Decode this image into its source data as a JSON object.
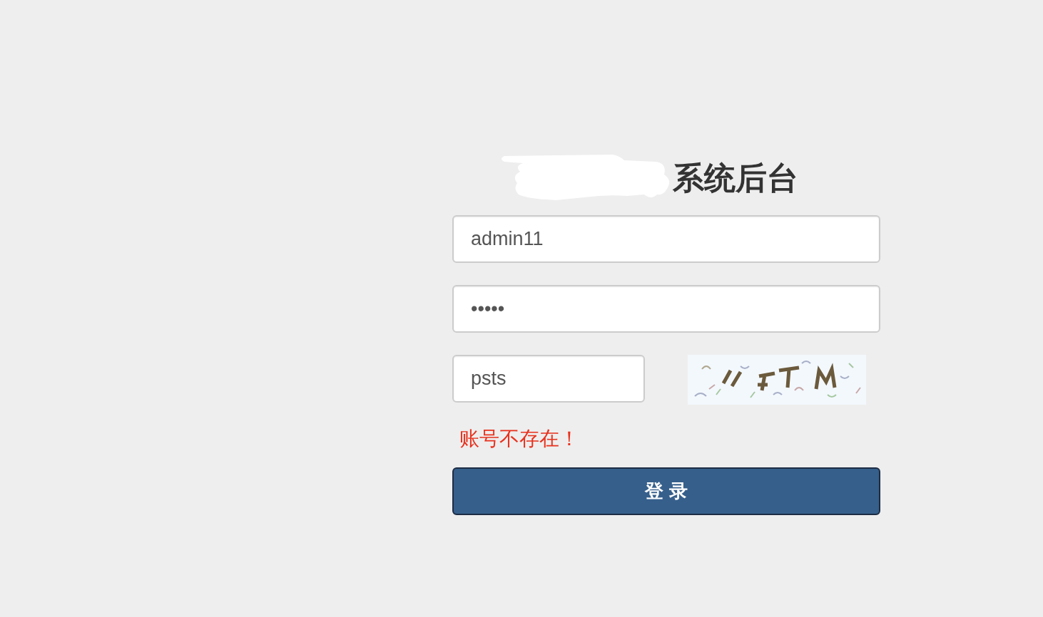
{
  "title": {
    "text": "系统后台",
    "redacted": true
  },
  "form": {
    "username": {
      "value": "admin11"
    },
    "password": {
      "value": "•••••"
    },
    "captcha": {
      "value": "psts"
    },
    "error": "账号不存在！",
    "submit": "登 录"
  }
}
